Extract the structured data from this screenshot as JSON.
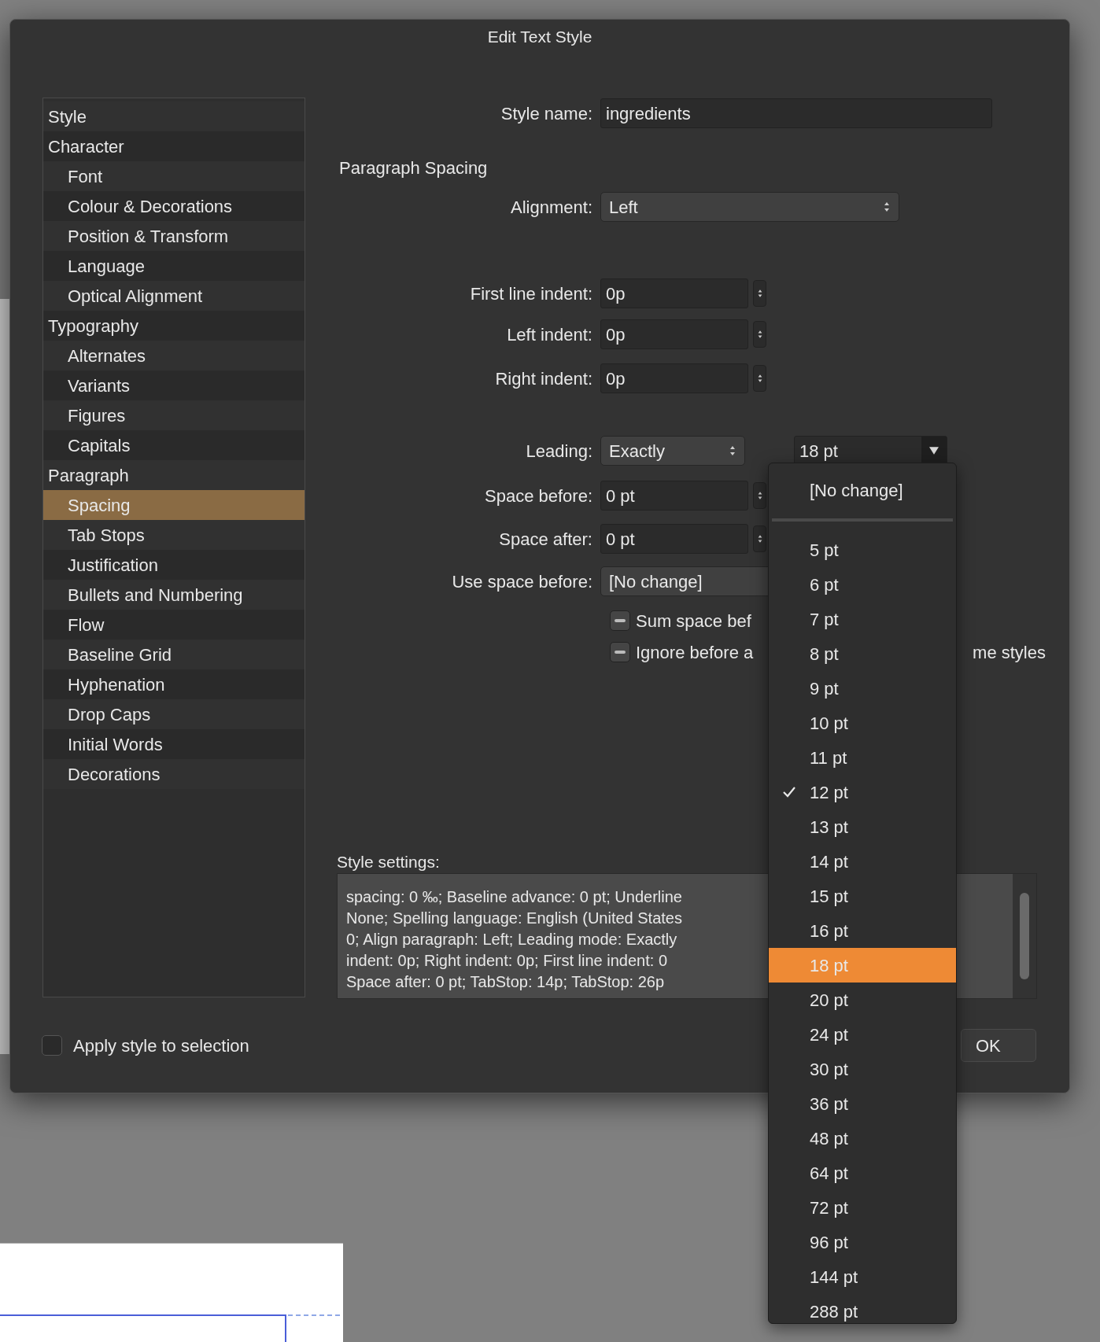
{
  "dialog": {
    "title": "Edit Text Style"
  },
  "sidebar": {
    "items": [
      {
        "label": "Style",
        "selected": false
      },
      {
        "label": "Character",
        "selected": false,
        "children": [
          {
            "label": "Font",
            "selected": false
          },
          {
            "label": "Colour & Decorations",
            "selected": false
          },
          {
            "label": "Position & Transform",
            "selected": false
          },
          {
            "label": "Language",
            "selected": false
          },
          {
            "label": "Optical Alignment",
            "selected": false
          }
        ]
      },
      {
        "label": "Typography",
        "selected": false,
        "children": [
          {
            "label": "Alternates",
            "selected": false
          },
          {
            "label": "Variants",
            "selected": false
          },
          {
            "label": "Figures",
            "selected": false
          },
          {
            "label": "Capitals",
            "selected": false
          }
        ]
      },
      {
        "label": "Paragraph",
        "selected": false,
        "children": [
          {
            "label": "Spacing",
            "selected": true
          },
          {
            "label": "Tab Stops",
            "selected": false
          },
          {
            "label": "Justification",
            "selected": false
          },
          {
            "label": "Bullets and Numbering",
            "selected": false
          },
          {
            "label": "Flow",
            "selected": false
          },
          {
            "label": "Baseline Grid",
            "selected": false
          },
          {
            "label": "Hyphenation",
            "selected": false
          },
          {
            "label": "Drop Caps",
            "selected": false
          },
          {
            "label": "Initial Words",
            "selected": false
          },
          {
            "label": "Decorations",
            "selected": false
          }
        ]
      }
    ]
  },
  "style_name": {
    "label": "Style name:",
    "value": "ingredients"
  },
  "section_heading": "Paragraph Spacing",
  "alignment": {
    "label": "Alignment:",
    "value": "Left"
  },
  "indents": [
    {
      "label": "First line indent:",
      "value": "0p"
    },
    {
      "label": "Left indent:",
      "value": "0p"
    },
    {
      "label": "Right indent:",
      "value": "0p"
    }
  ],
  "leading": {
    "label": "Leading:",
    "mode": "Exactly",
    "value": "18 pt"
  },
  "spacing_fields": [
    {
      "label": "Space before:",
      "value": "0 pt"
    },
    {
      "label": "Space after:",
      "value": "0 pt"
    }
  ],
  "use_space_before": {
    "label": "Use space before:",
    "value": "[No change]"
  },
  "checkboxes": [
    {
      "label": "Sum space bef",
      "mixed": true
    },
    {
      "label": "Ignore before a",
      "trailing": "me styles",
      "mixed": true
    }
  ],
  "style_settings": {
    "label": "Style settings:",
    "lines": [
      "spacing: 0 ‰; Baseline advance: 0 pt; Underline",
      "None; Spelling language: English (United States",
      "0; Align paragraph: Left; Leading mode: Exactly",
      "indent: 0p; Right indent: 0p; First line indent: 0",
      "Space after: 0 pt; TabStop: 14p; TabStop: 26p"
    ]
  },
  "apply_style": {
    "label": "Apply style to selection",
    "checked": false
  },
  "buttons": [
    "OK"
  ],
  "leading_menu": {
    "items": [
      {
        "kind": "option",
        "label": "[No change]",
        "checked": false,
        "highlighted": false
      },
      {
        "kind": "separator"
      },
      {
        "kind": "option",
        "label": "5 pt",
        "checked": false,
        "highlighted": false
      },
      {
        "kind": "option",
        "label": "6 pt",
        "checked": false,
        "highlighted": false
      },
      {
        "kind": "option",
        "label": "7 pt",
        "checked": false,
        "highlighted": false
      },
      {
        "kind": "option",
        "label": "8 pt",
        "checked": false,
        "highlighted": false
      },
      {
        "kind": "option",
        "label": "9 pt",
        "checked": false,
        "highlighted": false
      },
      {
        "kind": "option",
        "label": "10 pt",
        "checked": false,
        "highlighted": false
      },
      {
        "kind": "option",
        "label": "11 pt",
        "checked": false,
        "highlighted": false
      },
      {
        "kind": "option",
        "label": "12 pt",
        "checked": true,
        "highlighted": false
      },
      {
        "kind": "option",
        "label": "13 pt",
        "checked": false,
        "highlighted": false
      },
      {
        "kind": "option",
        "label": "14 pt",
        "checked": false,
        "highlighted": false
      },
      {
        "kind": "option",
        "label": "15 pt",
        "checked": false,
        "highlighted": false
      },
      {
        "kind": "option",
        "label": "16 pt",
        "checked": false,
        "highlighted": false
      },
      {
        "kind": "option",
        "label": "18 pt",
        "checked": false,
        "highlighted": true
      },
      {
        "kind": "option",
        "label": "20 pt",
        "checked": false,
        "highlighted": false
      },
      {
        "kind": "option",
        "label": "24 pt",
        "checked": false,
        "highlighted": false
      },
      {
        "kind": "option",
        "label": "30 pt",
        "checked": false,
        "highlighted": false
      },
      {
        "kind": "option",
        "label": "36 pt",
        "checked": false,
        "highlighted": false
      },
      {
        "kind": "option",
        "label": "48 pt",
        "checked": false,
        "highlighted": false
      },
      {
        "kind": "option",
        "label": "64 pt",
        "checked": false,
        "highlighted": false
      },
      {
        "kind": "option",
        "label": "72 pt",
        "checked": false,
        "highlighted": false
      },
      {
        "kind": "option",
        "label": "96 pt",
        "checked": false,
        "highlighted": false
      },
      {
        "kind": "option",
        "label": "144 pt",
        "checked": false,
        "highlighted": false
      },
      {
        "kind": "option",
        "label": "288 pt",
        "checked": false,
        "highlighted": false
      }
    ]
  }
}
